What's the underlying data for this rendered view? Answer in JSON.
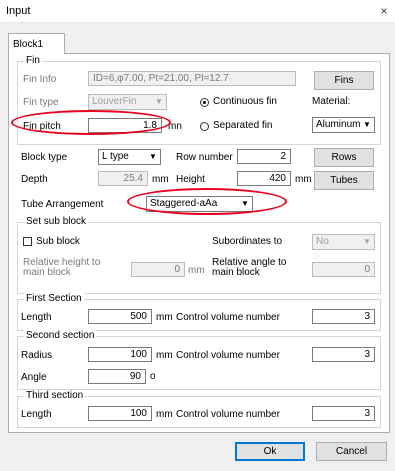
{
  "window": {
    "title": "Input",
    "close_glyph": "×"
  },
  "tab": {
    "label": "Block1"
  },
  "fin": {
    "group_title": "Fin",
    "info_label": "Fin Info",
    "info_value": "ID=6,φ7.00, Pt=21.00, Pl=12.7",
    "fins_button": "Fins",
    "type_label": "Fin type",
    "type_value": "LouverFin",
    "continuous_label": "Continuous fin",
    "separated_label": "Separated fin",
    "material_label": "Material:",
    "material_value": "Aluminum",
    "pitch_label": "Fin pitch",
    "pitch_value": "1.8",
    "pitch_unit": "mn"
  },
  "block": {
    "type_label": "Block type",
    "type_value": "L type",
    "row_label": "Row number",
    "row_value": "2",
    "rows_button": "Rows",
    "depth_label": "Depth",
    "depth_value": "25.4",
    "depth_unit": "mm",
    "height_label": "Height",
    "height_value": "420",
    "height_unit": "mm",
    "tubes_button": "Tubes",
    "arrangement_label": "Tube Arrangement",
    "arrangement_value": "Staggered-aAa"
  },
  "subblock": {
    "group_title": "Set sub block",
    "sub_label": "Sub block",
    "subordinates_label": "Subordinates to",
    "subordinates_value": "No",
    "rel_height_label_1": "Relative height to",
    "rel_height_label_2": "main block",
    "rel_height_value": "0",
    "rel_height_unit": "mm",
    "rel_angle_label_1": "Relative angle to",
    "rel_angle_label_2": "main block",
    "rel_angle_value": "0"
  },
  "first_section": {
    "group_title": "First Section",
    "length_label": "Length",
    "length_value": "500",
    "length_unit": "mm",
    "cv_label": "Control volume number",
    "cv_value": "3"
  },
  "second_section": {
    "group_title": "Second section",
    "radius_label": "Radius",
    "radius_value": "100",
    "radius_unit": "mm",
    "cv_label": "Control volume number",
    "cv_value": "3",
    "angle_label": "Angle",
    "angle_value": "90",
    "angle_unit": "o"
  },
  "third_section": {
    "group_title": "Third section",
    "length_label": "Length",
    "length_value": "100",
    "length_unit": "mm",
    "cv_label": "Control volume number",
    "cv_value": "3"
  },
  "footer": {
    "ok": "Ok",
    "cancel": "Cancel"
  },
  "annotation_color": "#e8001c"
}
